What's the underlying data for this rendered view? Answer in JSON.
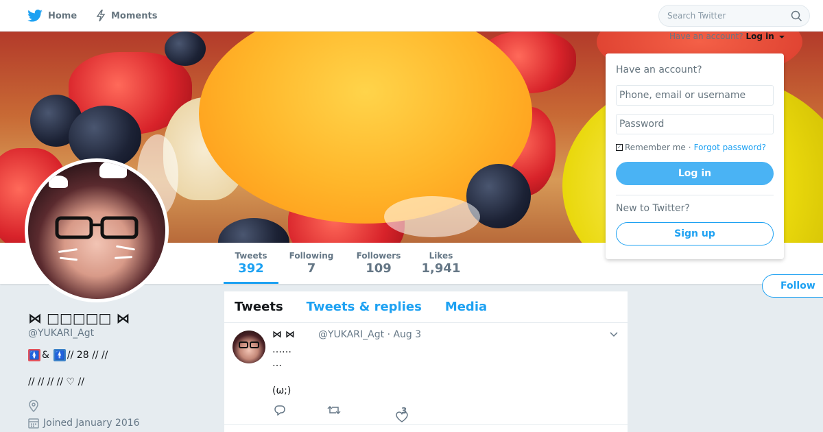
{
  "nav": {
    "home_label": "Home",
    "moments_label": "Moments",
    "search_placeholder": "Search Twitter"
  },
  "login_bar": {
    "have_account": "Have an account?",
    "login_link": "Log in"
  },
  "login_dropdown": {
    "title": "Have an account?",
    "username_placeholder": "Phone, email or username",
    "password_placeholder": "Password",
    "remember_label": "Remember me",
    "separator": "·",
    "forgot_label": "Forgot password?",
    "login_button": "Log in",
    "new_title": "New to Twitter?",
    "signup_button": "Sign up"
  },
  "stats": [
    {
      "label": "Tweets",
      "value": "392",
      "active": true
    },
    {
      "label": "Following",
      "value": "7",
      "active": false
    },
    {
      "label": "Followers",
      "value": "109",
      "active": false
    },
    {
      "label": "Likes",
      "value": "1,941",
      "active": false
    }
  ],
  "follow_button": "Follow",
  "profile": {
    "name": "⋈ □□□□□ ⋈",
    "handle": "@YUKARI_Agt",
    "bio_line1_text": " // 28 //  //",
    "bio_line1_amp": "&",
    "bio_line2": "//  //  //  // ♡ //",
    "joined": "Joined January 2016"
  },
  "timeline": {
    "tabs": [
      "Tweets",
      "Tweets & replies",
      "Media"
    ],
    "tweet": {
      "name": "⋈  ⋈",
      "handle_date": "@YUKARI_Agt · Aug 3",
      "text": "……\n…\n\n(ω;)",
      "like_count": "3"
    }
  },
  "colors": {
    "accent": "#1da1f2",
    "text": "#14171a",
    "muted": "#657786",
    "background": "#e6ecf0"
  },
  "icons": [
    "twitter-bird-icon",
    "moments-bolt-icon",
    "search-icon",
    "location-icon",
    "calendar-icon",
    "reply-icon",
    "retweet-icon",
    "like-icon",
    "chevron-down-icon"
  ]
}
